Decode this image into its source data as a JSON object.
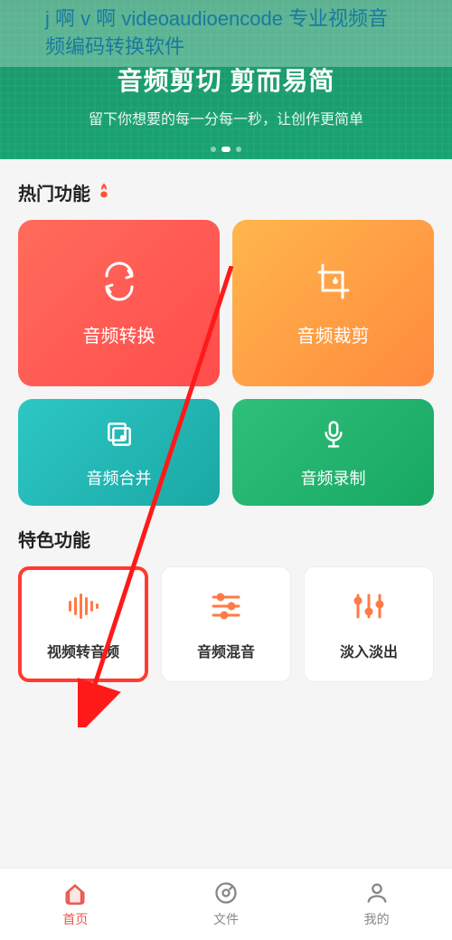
{
  "header": {
    "title": "j 啊 v 啊 videoaudioencode 专业视频音频编码转换软件"
  },
  "banner": {
    "title": "音频剪切 剪而易简",
    "subtitle": "留下你想要的每一分每一秒，让创作更简单"
  },
  "sections": {
    "hot_title": "热门功能",
    "special_title": "特色功能"
  },
  "hot": {
    "convert": "音频转换",
    "crop": "音频裁剪",
    "merge": "音频合并",
    "record": "音频录制"
  },
  "special": {
    "v2a": "视频转音频",
    "mix": "音频混音",
    "fade": "淡入淡出"
  },
  "tabs": {
    "home": "首页",
    "files": "文件",
    "mine": "我的"
  }
}
